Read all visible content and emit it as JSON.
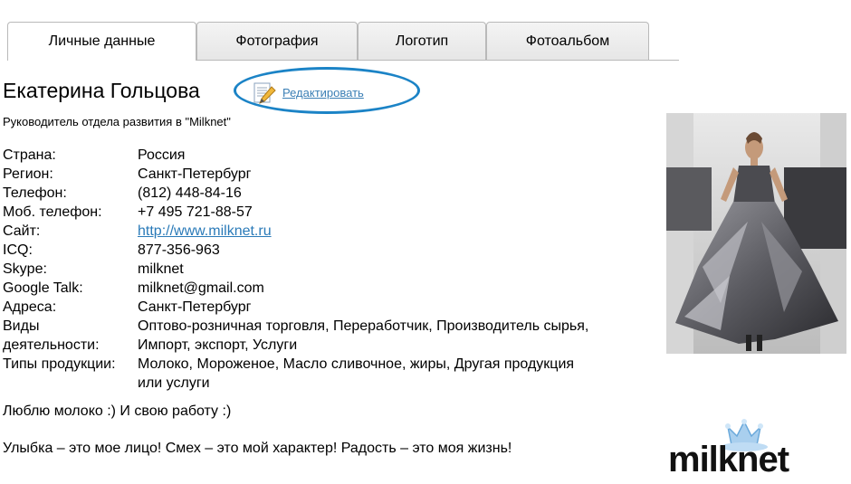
{
  "tabs": [
    {
      "label": "Личные данные"
    },
    {
      "label": "Фотография"
    },
    {
      "label": "Логотип"
    },
    {
      "label": "Фотоальбом"
    }
  ],
  "profile": {
    "name": "Екатерина Гольцова",
    "edit_label": "Редактировать",
    "position": "Руководитель отдела развития в \"Milknet\""
  },
  "details": [
    {
      "label": "Страна:",
      "value": "Россия"
    },
    {
      "label": "Регион:",
      "value": "Санкт-Петербург"
    },
    {
      "label": "Телефон:",
      "value": "(812) 448-84-16"
    },
    {
      "label": "Моб. телефон:",
      "value": "+7 495 721-88-57"
    },
    {
      "label": "Сайт:",
      "value": "http://www.milknet.ru"
    },
    {
      "label": "ICQ:",
      "value": "877-356-963"
    },
    {
      "label": "Skype:",
      "value": "milknet"
    },
    {
      "label": "Google Talk:",
      "value": "milknet@gmail.com"
    },
    {
      "label": "Адреса:",
      "value": "Санкт-Петербург"
    },
    {
      "label": "Виды деятельности:",
      "value": "Оптово-розничная торговля, Переработчик, Производитель сырья, Импорт, экспорт, Услуги"
    },
    {
      "label": "Типы продукции:",
      "value": "Молоко, Мороженое, Масло сливочное, жиры, Другая продукция или услуги"
    }
  ],
  "about": {
    "line1": "Люблю молоко :) И свою работу :)",
    "line2": "Улыбка – это мое лицо! Смех – это мой характер! Радость – это моя жизнь!"
  },
  "logo": {
    "text": "milknet"
  },
  "colors": {
    "link": "#3b7fb5",
    "highlight_oval": "#1b83c6"
  }
}
